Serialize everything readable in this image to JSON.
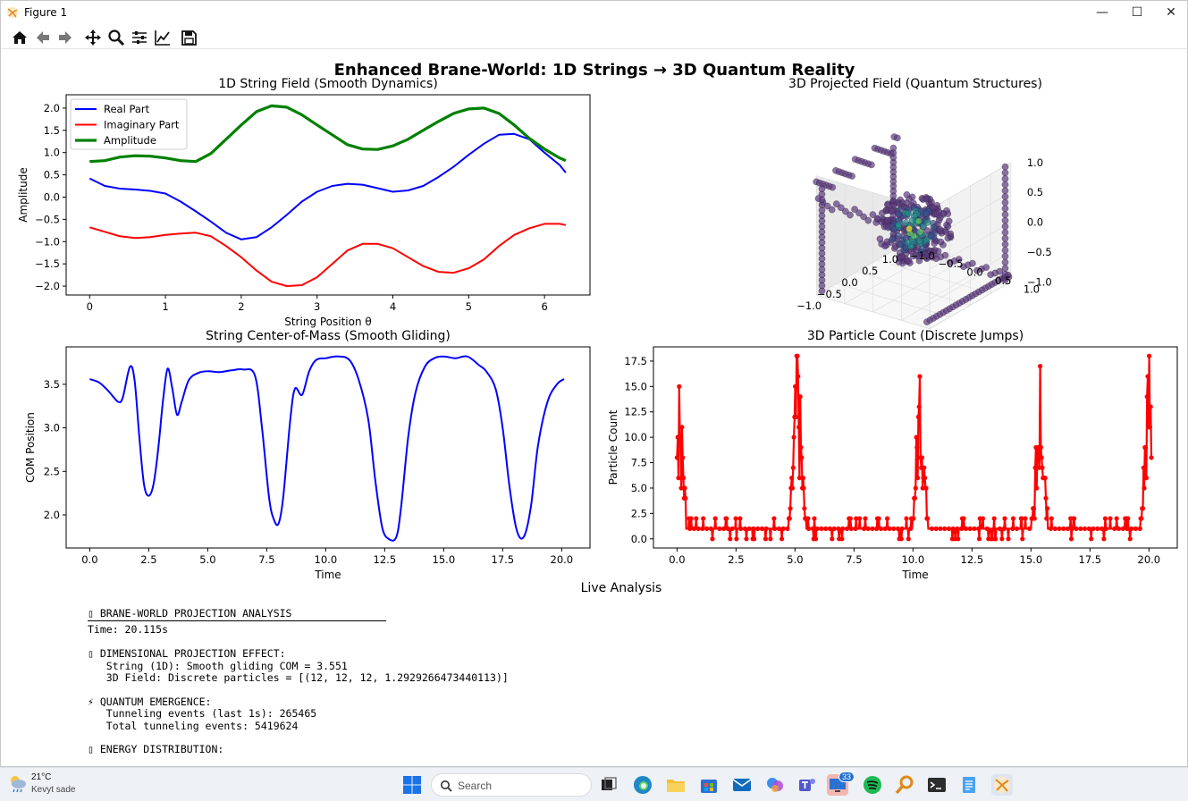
{
  "window": {
    "title": "Figure 1",
    "minimize_glyph": "—",
    "maximize_glyph": "☐",
    "close_glyph": "✕"
  },
  "toolbar": {
    "buttons": [
      "home-icon",
      "back-arrow-icon",
      "forward-arrow-icon",
      "pan-icon",
      "zoom-icon",
      "configure-subplots-icon",
      "edit-axis-icon",
      "save-icon"
    ]
  },
  "figure": {
    "suptitle": "Enhanced Brane-World: 1D Strings → 3D Quantum Reality",
    "live_analysis_title": "Live Analysis"
  },
  "chart_data": [
    {
      "id": "string-field",
      "type": "line",
      "title": "1D String Field (Smooth Dynamics)",
      "xlabel": "String Position θ",
      "ylabel": "Amplitude",
      "xlim": [
        -0.31,
        6.6
      ],
      "ylim": [
        -2.2,
        2.3
      ],
      "xticks": [
        0,
        1,
        2,
        3,
        4,
        5,
        6
      ],
      "yticks": [
        -2.0,
        -1.5,
        -1.0,
        -0.5,
        0.0,
        0.5,
        1.0,
        1.5,
        2.0
      ],
      "ytick_labels": [
        "−2.0",
        "−1.5",
        "−1.0",
        "−0.5",
        "0.0",
        "0.5",
        "1.0",
        "1.5",
        "2.0"
      ],
      "legend": "top-left",
      "x": [
        0.0,
        0.2,
        0.4,
        0.6,
        0.8,
        1.0,
        1.2,
        1.4,
        1.6,
        1.8,
        2.0,
        2.2,
        2.4,
        2.6,
        2.8,
        3.0,
        3.2,
        3.4,
        3.6,
        3.8,
        4.0,
        4.2,
        4.4,
        4.6,
        4.8,
        5.0,
        5.2,
        5.4,
        5.6,
        5.8,
        6.0,
        6.2,
        6.28
      ],
      "series": [
        {
          "name": "Real Part",
          "color": "#0000ff",
          "width": 2,
          "values": [
            0.42,
            0.25,
            0.19,
            0.17,
            0.14,
            0.08,
            -0.1,
            -0.32,
            -0.55,
            -0.8,
            -0.95,
            -0.9,
            -0.68,
            -0.4,
            -0.1,
            0.12,
            0.25,
            0.3,
            0.28,
            0.2,
            0.12,
            0.15,
            0.25,
            0.45,
            0.68,
            0.95,
            1.2,
            1.4,
            1.42,
            1.3,
            1.0,
            0.72,
            0.55
          ]
        },
        {
          "name": "Imaginary Part",
          "color": "#ff0000",
          "width": 2,
          "values": [
            -0.68,
            -0.78,
            -0.88,
            -0.92,
            -0.9,
            -0.85,
            -0.82,
            -0.8,
            -0.88,
            -1.1,
            -1.35,
            -1.65,
            -1.9,
            -2.0,
            -1.98,
            -1.8,
            -1.5,
            -1.2,
            -1.05,
            -1.05,
            -1.15,
            -1.35,
            -1.55,
            -1.68,
            -1.7,
            -1.6,
            -1.4,
            -1.1,
            -0.85,
            -0.7,
            -0.6,
            -0.6,
            -0.63
          ]
        },
        {
          "name": "Amplitude",
          "color": "#008000",
          "width": 3.2,
          "values": [
            0.8,
            0.82,
            0.9,
            0.93,
            0.92,
            0.88,
            0.82,
            0.8,
            0.98,
            1.3,
            1.62,
            1.92,
            2.05,
            2.02,
            1.85,
            1.62,
            1.4,
            1.18,
            1.08,
            1.07,
            1.15,
            1.3,
            1.5,
            1.7,
            1.88,
            1.98,
            2.0,
            1.88,
            1.62,
            1.32,
            1.08,
            0.88,
            0.82
          ]
        }
      ]
    },
    {
      "id": "projected-field",
      "type": "scatter",
      "title": "3D Projected Field (Quantum Structures)",
      "z_tick_labels": [
        "1.0",
        "0.5",
        "0.0",
        "−0.5",
        "−1.0"
      ],
      "x_tick_labels": [
        "−1.0",
        "−0.5",
        "0.0",
        "0.5",
        "1.0"
      ],
      "y_tick_labels": [
        "1.0",
        "0.5",
        "0.0",
        "−0.5",
        "−1.0"
      ]
    },
    {
      "id": "com",
      "type": "line",
      "title": "String Center-of-Mass (Smooth Gliding)",
      "xlabel": "Time",
      "ylabel": "COM Position",
      "xlim": [
        -1.0,
        21.2
      ],
      "ylim": [
        1.62,
        3.93
      ],
      "xticks": [
        0.0,
        2.5,
        5.0,
        7.5,
        10.0,
        12.5,
        15.0,
        17.5,
        20.0
      ],
      "yticks": [
        2.0,
        2.5,
        3.0,
        3.5
      ],
      "series": [
        {
          "name": "",
          "color": "#0000ff",
          "width": 2,
          "x": [
            0.0,
            0.4,
            0.8,
            1.2,
            1.4,
            1.7,
            1.9,
            2.1,
            2.3,
            2.5,
            2.7,
            2.9,
            3.1,
            3.3,
            3.5,
            3.7,
            3.9,
            4.2,
            4.6,
            5.0,
            5.5,
            6.0,
            6.5,
            7.0,
            7.3,
            7.6,
            7.8,
            8.0,
            8.2,
            8.5,
            8.7,
            9.0,
            9.3,
            9.6,
            10.0,
            10.5,
            11.0,
            11.4,
            11.8,
            12.1,
            12.4,
            12.7,
            13.0,
            13.2,
            13.5,
            13.8,
            14.2,
            14.6,
            15.0,
            15.5,
            16.0,
            16.5,
            16.8,
            17.2,
            17.5,
            17.8,
            18.1,
            18.4,
            18.7,
            19.0,
            19.4,
            19.8,
            20.1
          ],
          "values": [
            3.56,
            3.52,
            3.42,
            3.3,
            3.35,
            3.7,
            3.55,
            2.9,
            2.35,
            2.22,
            2.35,
            2.75,
            3.3,
            3.68,
            3.45,
            3.15,
            3.3,
            3.55,
            3.63,
            3.65,
            3.64,
            3.66,
            3.67,
            3.6,
            3.0,
            2.2,
            1.95,
            1.9,
            2.2,
            3.1,
            3.45,
            3.38,
            3.65,
            3.78,
            3.8,
            3.82,
            3.78,
            3.55,
            3.1,
            2.4,
            1.85,
            1.72,
            1.75,
            2.1,
            2.9,
            3.4,
            3.7,
            3.8,
            3.82,
            3.8,
            3.82,
            3.72,
            3.65,
            3.45,
            3.0,
            2.3,
            1.82,
            1.75,
            2.1,
            2.8,
            3.3,
            3.5,
            3.56
          ]
        }
      ]
    },
    {
      "id": "particle-count",
      "type": "line",
      "title": "3D Particle Count (Discrete Jumps)",
      "xlabel": "Time",
      "ylabel": "Particle Count",
      "xlim": [
        -1.0,
        21.2
      ],
      "ylim": [
        -0.9,
        18.9
      ],
      "xticks": [
        0.0,
        2.5,
        5.0,
        7.5,
        10.0,
        12.5,
        15.0,
        17.5,
        20.0
      ],
      "yticks": [
        0.0,
        2.5,
        5.0,
        7.5,
        10.0,
        12.5,
        15.0,
        17.5
      ],
      "series_color": "#ff0000",
      "burst_centers": [
        0.1,
        5.1,
        10.3,
        15.4,
        20.0
      ],
      "burst_peaks": [
        15,
        18,
        16,
        17,
        18
      ],
      "baseline": 1
    }
  ],
  "analysis": {
    "header": "▯ BRANE-WORLD PROJECTION ANALYSIS",
    "time": "Time: 20.115s",
    "dim_header": "▯ DIMENSIONAL PROJECTION EFFECT:",
    "dim_line1": "   String (1D): Smooth gliding COM = 3.551",
    "dim_line2": "   3D Field: Discrete particles = [(12, 12, 12, 1.2929266473440113)]",
    "quantum_header": "⚡ QUANTUM EMERGENCE:",
    "quantum_line1": "   Tunneling events (last 1s): 265465",
    "quantum_line2": "   Total tunneling events: 5419624",
    "energy_header": "▯ ENERGY DISTRIBUTION:"
  },
  "taskbar": {
    "weather_temp": "21°C",
    "weather_condition": "Kevyt sade",
    "search_placeholder": "Search",
    "notification_badge": "33"
  }
}
